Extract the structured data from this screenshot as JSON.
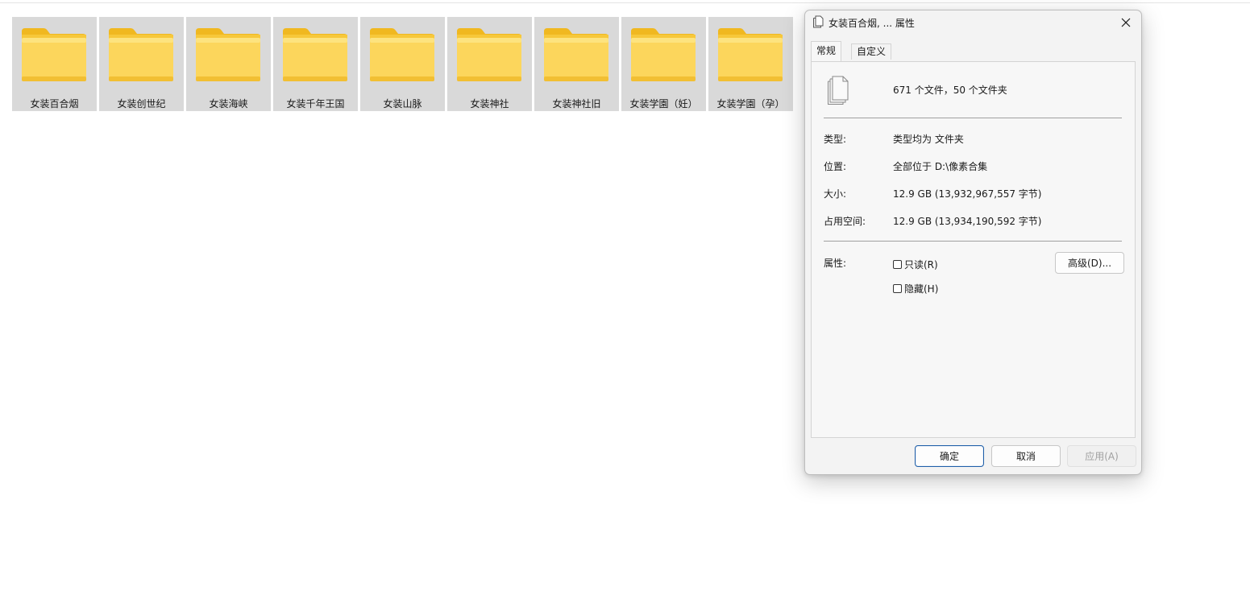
{
  "folders": [
    {
      "label": "女装百合烟"
    },
    {
      "label": "女装创世纪"
    },
    {
      "label": "女装海峡"
    },
    {
      "label": "女装千年王国"
    },
    {
      "label": "女装山脉"
    },
    {
      "label": "女装神社"
    },
    {
      "label": "女装神社旧"
    },
    {
      "label": "女装学園（妊）"
    },
    {
      "label": "女装学園（孕）"
    }
  ],
  "dialog": {
    "title": "女装百合烟, ... 属性",
    "close_icon": "close-icon",
    "tabs": [
      {
        "label": "常规",
        "active": true
      },
      {
        "label": "自定义",
        "active": false
      }
    ],
    "summary": "671 个文件，50 个文件夹",
    "rows": {
      "type_label": "类型:",
      "type_value": "类型均为 文件夹",
      "location_label": "位置:",
      "location_value": "全部位于 D:\\像素合集",
      "size_label": "大小:",
      "size_value": "12.9 GB (13,932,967,557 字节)",
      "disk_label": "占用空间:",
      "disk_value": "12.9 GB (13,934,190,592 字节)"
    },
    "attributes": {
      "label": "属性:",
      "readonly_label": "只读(R)",
      "readonly_checked": false,
      "hidden_label": "隐藏(H)",
      "hidden_checked": false,
      "advanced_label": "高级(D)..."
    },
    "buttons": {
      "ok": "确定",
      "cancel": "取消",
      "apply": "应用(A)"
    }
  },
  "colors": {
    "folder_back": "#f0b820",
    "folder_front": "#fcd65c",
    "tile_selected": "#d9d9d9",
    "accent_border": "#1f5fa8"
  }
}
